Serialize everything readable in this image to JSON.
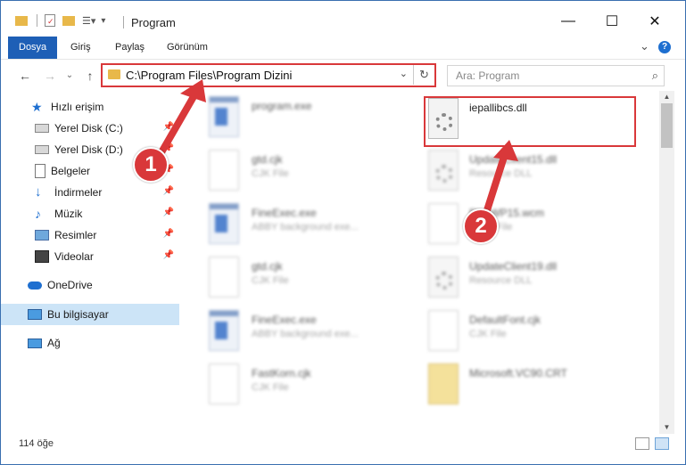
{
  "window": {
    "title": "Program",
    "minimize": "—",
    "maximize": "☐",
    "close": "✕"
  },
  "ribbon": {
    "tabs": [
      "Dosya",
      "Giriş",
      "Paylaş",
      "Görünüm"
    ],
    "collapse": "⌄",
    "help": "?"
  },
  "address": {
    "path": "C:\\Program Files\\Program Dizini",
    "dropdown": "⌄",
    "refresh": "↻"
  },
  "search": {
    "placeholder": "Ara: Program",
    "icon": "search-icon"
  },
  "nav": {
    "back": "←",
    "forward": "→",
    "recent": "⌄",
    "up": "↑"
  },
  "sidebar": {
    "items": [
      {
        "label": "Hızlı erişim",
        "icon": "star-icon",
        "pinned": false
      },
      {
        "label": "Yerel Disk (C:)",
        "icon": "drive-icon",
        "pinned": true
      },
      {
        "label": "Yerel Disk (D:)",
        "icon": "drive-icon",
        "pinned": true
      },
      {
        "label": "Belgeler",
        "icon": "documents-icon",
        "pinned": true
      },
      {
        "label": "İndirmeler",
        "icon": "downloads-icon",
        "pinned": true
      },
      {
        "label": "Müzik",
        "icon": "music-icon",
        "pinned": true
      },
      {
        "label": "Resimler",
        "icon": "pictures-icon",
        "pinned": true
      },
      {
        "label": "Videolar",
        "icon": "videos-icon",
        "pinned": true
      },
      {
        "label": "OneDrive",
        "icon": "cloud-icon",
        "pinned": false
      },
      {
        "label": "Bu bilgisayar",
        "icon": "computer-icon",
        "pinned": false
      },
      {
        "label": "Ağ",
        "icon": "network-icon",
        "pinned": false
      }
    ]
  },
  "files": [
    {
      "name": "program.exe",
      "desc": "",
      "kind": "exe",
      "blurred": true
    },
    {
      "name": "iepallibcs.dll",
      "desc": "",
      "kind": "dll",
      "blurred": false
    },
    {
      "name": "gtd.cjk",
      "desc": "CJK File",
      "kind": "doc",
      "blurred": true
    },
    {
      "name": "UpdateClient15.dll",
      "desc": "Resource DLL",
      "kind": "dll",
      "blurred": true
    },
    {
      "name": "FineExec.exe",
      "desc": "ABBY background exe...",
      "kind": "exe",
      "blurred": true
    },
    {
      "name": "FineWP15.wcm",
      "desc": "WCM File",
      "kind": "doc",
      "blurred": true
    },
    {
      "name": "gtd.cjk",
      "desc": "CJK File",
      "kind": "doc",
      "blurred": true
    },
    {
      "name": "UpdateClient19.dll",
      "desc": "Resource DLL",
      "kind": "dll",
      "blurred": true
    },
    {
      "name": "FineExec.exe",
      "desc": "ABBY background exe...",
      "kind": "exe",
      "blurred": true
    },
    {
      "name": "DefaultFont.cjk",
      "desc": "CJK File",
      "kind": "doc",
      "blurred": true
    },
    {
      "name": "FastKorn.cjk",
      "desc": "CJK File",
      "kind": "doc",
      "blurred": true
    },
    {
      "name": "Microsoft.VC90.CRT",
      "desc": "",
      "kind": "folder",
      "blurred": true
    }
  ],
  "status": {
    "count": "114 öğe"
  },
  "annotations": {
    "step1": "1",
    "step2": "2",
    "color": "#d9383a"
  }
}
